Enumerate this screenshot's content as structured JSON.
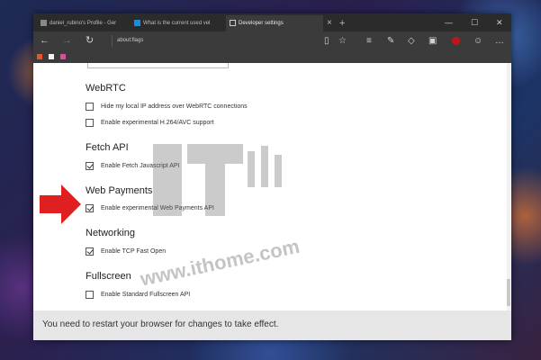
{
  "tabs": [
    {
      "label": "daniel_rubino's Profile - Ger",
      "icon": "profile-icon",
      "active": false
    },
    {
      "label": "What is the current used vel",
      "icon": "bing-icon",
      "active": false
    },
    {
      "label": "Developer settings",
      "icon": "page-icon",
      "active": true
    }
  ],
  "new_tab_label": "+",
  "window_controls": {
    "minimize": "—",
    "maximize": "☐",
    "close": "✕"
  },
  "nav": {
    "back": "←",
    "forward": "→",
    "refresh": "↻",
    "address": "about:flags"
  },
  "toolbar_icons": [
    "reading-view-icon",
    "favorite-star-icon",
    "hub-icon",
    "web-note-icon",
    "share-icon",
    "extension-icon",
    "adblock-icon",
    "feedback-icon",
    "more-icon"
  ],
  "favorites": [
    "fav-1-icon",
    "fav-2-icon",
    "fav-3-icon"
  ],
  "sections": [
    {
      "title": "WebRTC",
      "options": [
        {
          "label": "Hide my local IP address over WebRTC connections",
          "checked": false
        },
        {
          "label": "Enable experimental H.264/AVC support",
          "checked": false
        }
      ]
    },
    {
      "title": "Fetch API",
      "options": [
        {
          "label": "Enable Fetch Javascript API",
          "checked": true
        }
      ]
    },
    {
      "title": "Web Payments",
      "options": [
        {
          "label": "Enable experimental Web Payments API",
          "checked": true
        }
      ]
    },
    {
      "title": "Networking",
      "options": [
        {
          "label": "Enable TCP Fast Open",
          "checked": true
        }
      ]
    },
    {
      "title": "Fullscreen",
      "options": [
        {
          "label": "Enable Standard Fullscreen API",
          "checked": false
        }
      ]
    }
  ],
  "footer": {
    "message": "You need to restart your browser for changes to take effect."
  },
  "watermark": {
    "text": "www.ithome.com"
  },
  "colors": {
    "chrome_dark": "#2b2b2b",
    "chrome_mid": "#3b3b3b",
    "arrow_red": "#e02020",
    "footer_bg": "#e6e6e6"
  }
}
